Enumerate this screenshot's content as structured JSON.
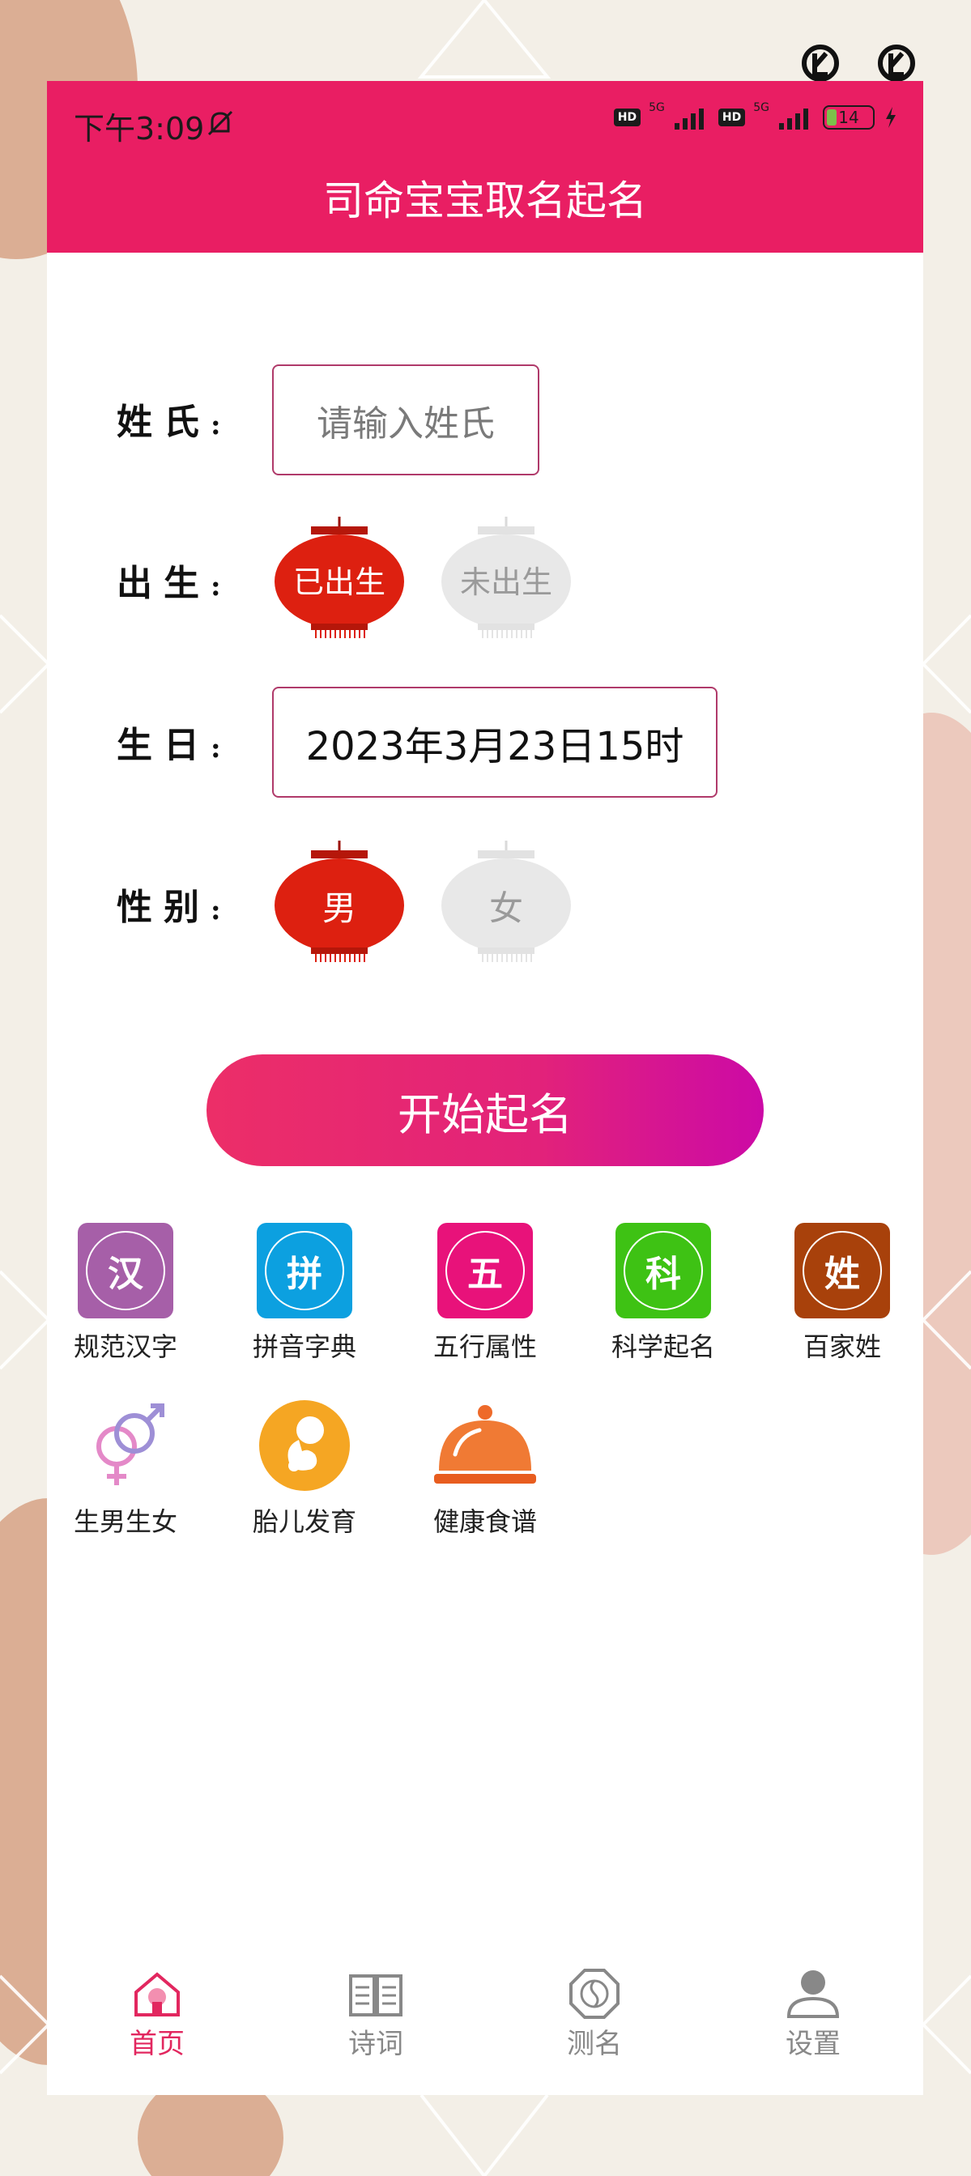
{
  "status_bar": {
    "time": "下午3:09",
    "hd_badge": "HD",
    "network_label": "5G",
    "battery_level": "14"
  },
  "app": {
    "title": "司命宝宝取名起名"
  },
  "form": {
    "surname_label": "姓氏",
    "surname_placeholder": "请输入姓氏",
    "birth_status_label": "出生",
    "born_option": "已出生",
    "unborn_option": "未出生",
    "birthday_label": "生日",
    "birthday_value": "2023年3月23日15时",
    "gender_label": "性别",
    "male_option": "男",
    "female_option": "女",
    "colon": ":"
  },
  "start_button": "开始起名",
  "features": [
    {
      "glyph": "汉",
      "label": "规范汉字",
      "icon": "han-icon",
      "color": "#a65fa8"
    },
    {
      "glyph": "拼",
      "label": "拼音字典",
      "icon": "pinyin-icon",
      "color": "#0ca0e0"
    },
    {
      "glyph": "五",
      "label": "五行属性",
      "icon": "wuxing-icon",
      "color": "#e8127a"
    },
    {
      "glyph": "科",
      "label": "科学起名",
      "icon": "science-icon",
      "color": "#3ec214"
    },
    {
      "glyph": "姓",
      "label": "百家姓",
      "icon": "surname-icon",
      "color": "#a8410b"
    },
    {
      "label": "生男生女",
      "icon": "gender-symbols-icon"
    },
    {
      "label": "胎儿发育",
      "icon": "fetus-icon"
    },
    {
      "label": "健康食谱",
      "icon": "food-cloche-icon"
    }
  ],
  "tabs": [
    {
      "label": "首页",
      "icon": "home-icon",
      "active": true
    },
    {
      "label": "诗词",
      "icon": "book-icon",
      "active": false
    },
    {
      "label": "测名",
      "icon": "bagua-icon",
      "active": false
    },
    {
      "label": "设置",
      "icon": "user-icon",
      "active": false
    }
  ],
  "colors": {
    "primary": "#e91e63",
    "lantern_active": "#dd2010",
    "lantern_inactive": "#e6e6e6",
    "tab_inactive": "#888888"
  }
}
